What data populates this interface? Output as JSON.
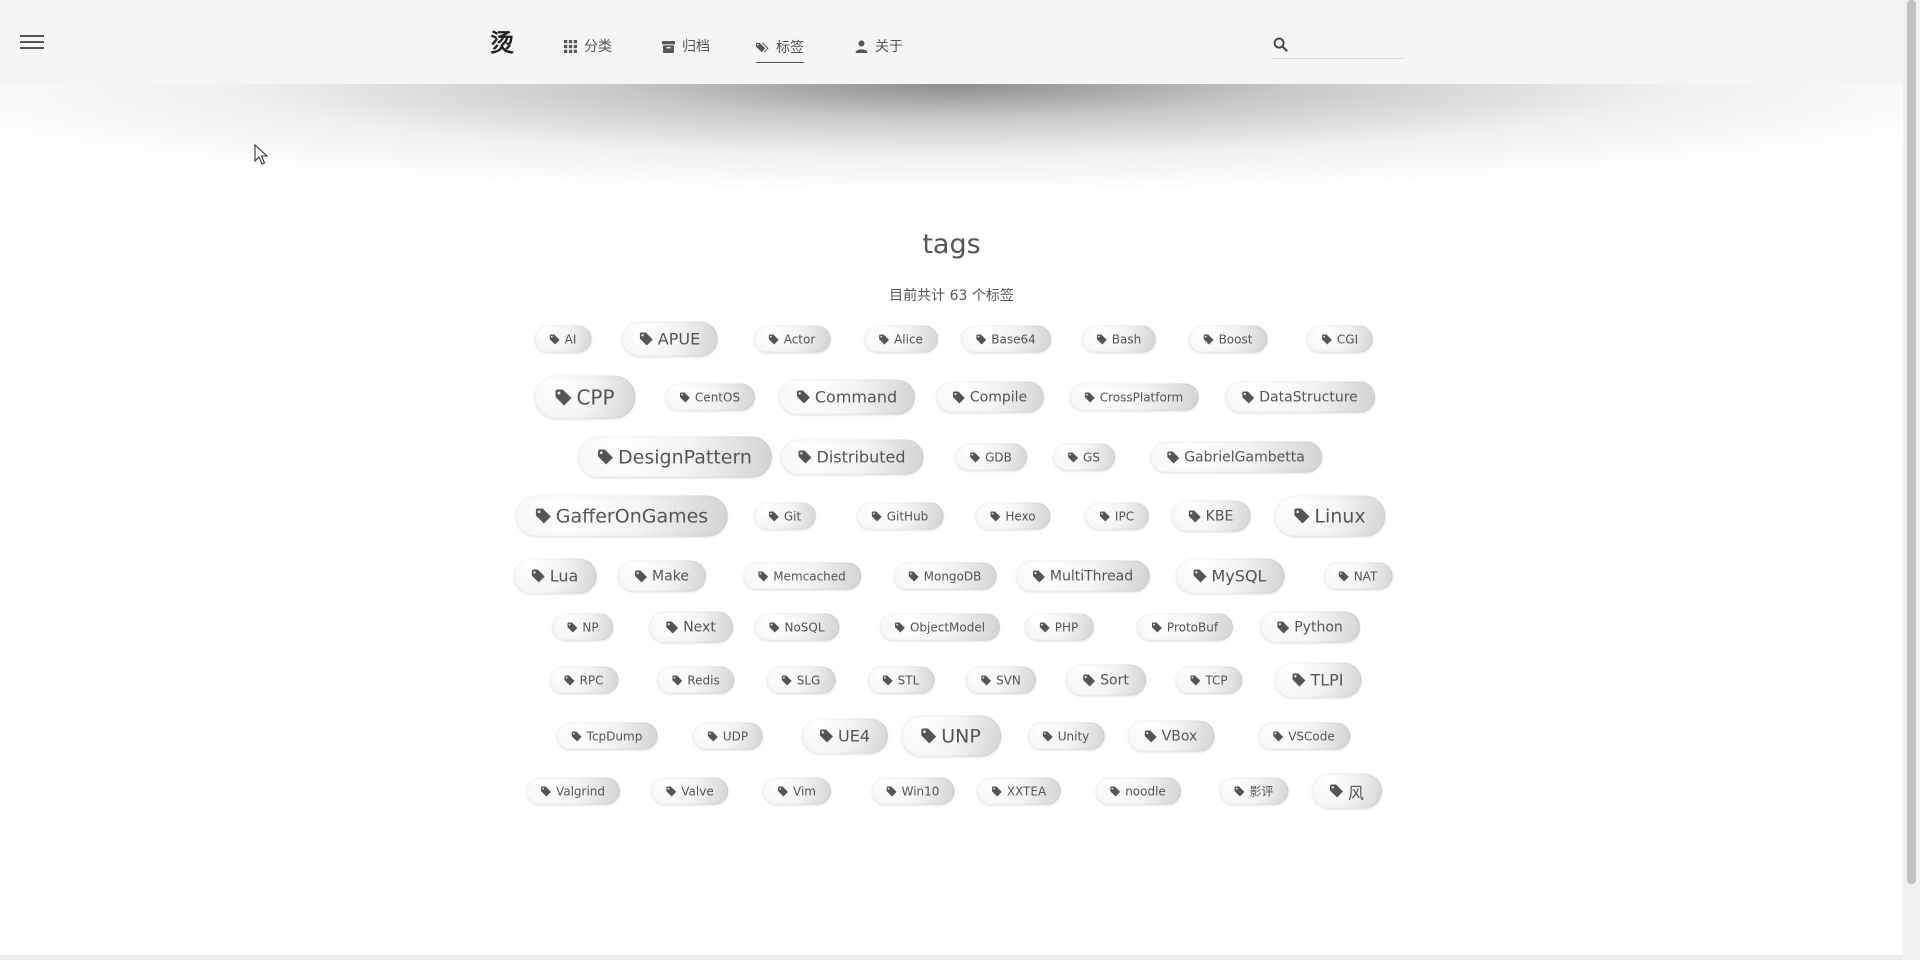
{
  "header": {
    "brand": "烫",
    "nav": [
      {
        "label": "分类",
        "icon": "grid-icon"
      },
      {
        "label": "归档",
        "icon": "archive-icon"
      },
      {
        "label": "标签",
        "icon": "tags-icon",
        "active": true
      },
      {
        "label": "关于",
        "icon": "user-icon"
      }
    ],
    "search": {
      "placeholder": "",
      "value": "",
      "icon": "search-icon"
    }
  },
  "page": {
    "title": "tags",
    "subtitle": "目前共计 63 个标签"
  },
  "tag_icon": "tag-icon",
  "tags": [
    {
      "label": "AI",
      "size": 1
    },
    {
      "label": "APUE",
      "size": 3
    },
    {
      "label": "Actor",
      "size": 1
    },
    {
      "label": "Alice",
      "size": 1
    },
    {
      "label": "Base64",
      "size": 1
    },
    {
      "label": "Bash",
      "size": 1
    },
    {
      "label": "Boost",
      "size": 1
    },
    {
      "label": "CGI",
      "size": 1
    },
    {
      "label": "CPP",
      "size": 5
    },
    {
      "label": "CentOS",
      "size": 1
    },
    {
      "label": "Command",
      "size": 3
    },
    {
      "label": "Compile",
      "size": 2
    },
    {
      "label": "CrossPlatform",
      "size": 1
    },
    {
      "label": "DataStructure",
      "size": 2
    },
    {
      "label": "DesignPattern",
      "size": 4
    },
    {
      "label": "Distributed",
      "size": 3
    },
    {
      "label": "GDB",
      "size": 1
    },
    {
      "label": "GS",
      "size": 1
    },
    {
      "label": "GabrielGambetta",
      "size": 2
    },
    {
      "label": "GafferOnGames",
      "size": 4
    },
    {
      "label": "Git",
      "size": 1
    },
    {
      "label": "GitHub",
      "size": 1
    },
    {
      "label": "Hexo",
      "size": 1
    },
    {
      "label": "IPC",
      "size": 1
    },
    {
      "label": "KBE",
      "size": 2
    },
    {
      "label": "Linux",
      "size": 4
    },
    {
      "label": "Lua",
      "size": 3
    },
    {
      "label": "Make",
      "size": 2
    },
    {
      "label": "Memcached",
      "size": 1
    },
    {
      "label": "MongoDB",
      "size": 1
    },
    {
      "label": "MultiThread",
      "size": 2
    },
    {
      "label": "MySQL",
      "size": 3
    },
    {
      "label": "NAT",
      "size": 1
    },
    {
      "label": "NP",
      "size": 1
    },
    {
      "label": "Next",
      "size": 2
    },
    {
      "label": "NoSQL",
      "size": 1
    },
    {
      "label": "ObjectModel",
      "size": 1
    },
    {
      "label": "PHP",
      "size": 1
    },
    {
      "label": "ProtoBuf",
      "size": 1
    },
    {
      "label": "Python",
      "size": 2
    },
    {
      "label": "RPC",
      "size": 1
    },
    {
      "label": "Redis",
      "size": 1
    },
    {
      "label": "SLG",
      "size": 1
    },
    {
      "label": "STL",
      "size": 1
    },
    {
      "label": "SVN",
      "size": 1
    },
    {
      "label": "Sort",
      "size": 2
    },
    {
      "label": "TCP",
      "size": 1
    },
    {
      "label": "TLPI",
      "size": 3
    },
    {
      "label": "TcpDump",
      "size": 1
    },
    {
      "label": "UDP",
      "size": 1
    },
    {
      "label": "UE4",
      "size": 3
    },
    {
      "label": "UNP",
      "size": 4
    },
    {
      "label": "Unity",
      "size": 1
    },
    {
      "label": "VBox",
      "size": 2
    },
    {
      "label": "VSCode",
      "size": 1
    },
    {
      "label": "Valgrind",
      "size": 1
    },
    {
      "label": "Valve",
      "size": 1
    },
    {
      "label": "Vim",
      "size": 1
    },
    {
      "label": "Win10",
      "size": 1
    },
    {
      "label": "XXTEA",
      "size": 1
    },
    {
      "label": "noodle",
      "size": 1
    },
    {
      "label": "影评",
      "size": 1
    },
    {
      "label": "风",
      "size": 3
    }
  ]
}
